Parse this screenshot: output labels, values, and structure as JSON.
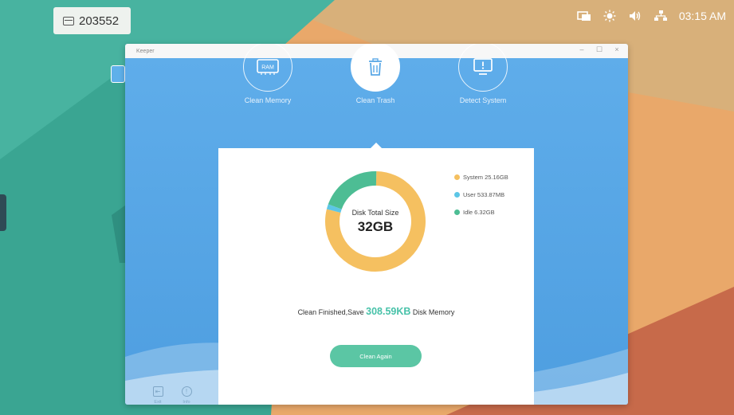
{
  "desktop": {
    "badge_id": "203552"
  },
  "statusbar": {
    "time": "03:15 AM",
    "icons": [
      "screen-mirror-icon",
      "brightness-icon",
      "volume-icon",
      "network-icon"
    ]
  },
  "window": {
    "title": "Keeper",
    "controls": {
      "minimize": "–",
      "maximize": "☐",
      "close": "×"
    },
    "features": [
      {
        "label": "Clean Memory",
        "icon": "ram-icon",
        "icon_text": "RAM",
        "active": false
      },
      {
        "label": "Clean Trash",
        "icon": "trash-icon",
        "active": true
      },
      {
        "label": "Detect System",
        "icon": "monitor-alert-icon",
        "active": false
      }
    ],
    "disk": {
      "center_label": "Disk Total Size",
      "center_value": "32GB",
      "legend": [
        {
          "label": "System 25.16GB",
          "color": "#f5c060"
        },
        {
          "label": "User 533.87MB",
          "color": "#5cc6e6"
        },
        {
          "label": "Idle 6.32GB",
          "color": "#4dbd94"
        }
      ],
      "segments": [
        {
          "name": "System",
          "value": 25.16,
          "color": "#f5c060"
        },
        {
          "name": "User",
          "value": 0.52,
          "color": "#5cc6e6"
        },
        {
          "name": "Idle",
          "value": 6.32,
          "color": "#4dbd94"
        }
      ]
    },
    "result": {
      "prefix": "Clean Finished,Save ",
      "saved": "308.59KB",
      "suffix": " Disk Memory"
    },
    "clean_again_label": "Clean Again",
    "bottom": [
      {
        "label": "Exit",
        "icon": "exit-icon"
      },
      {
        "label": "Info",
        "icon": "info-icon"
      }
    ]
  }
}
